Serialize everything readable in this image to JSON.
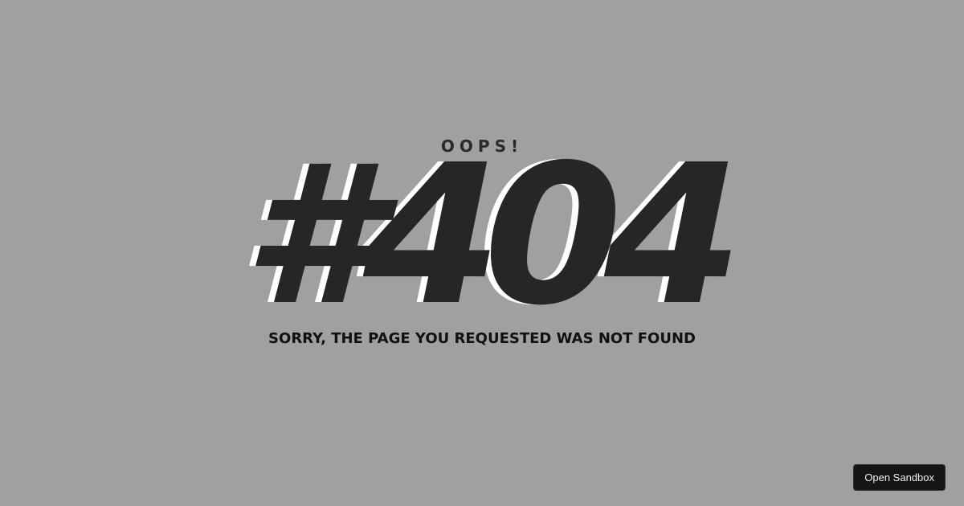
{
  "error": {
    "eyebrow": "OOPS!",
    "code": "#404",
    "message": "SORRY, THE PAGE YOU REQUESTED WAS NOT FOUND"
  },
  "sandbox_button": {
    "label": "Open Sandbox"
  },
  "colors": {
    "background": "#a0a0a0",
    "code_fill": "#262626",
    "code_shadow": "#ffffff",
    "button_bg": "#151515"
  }
}
